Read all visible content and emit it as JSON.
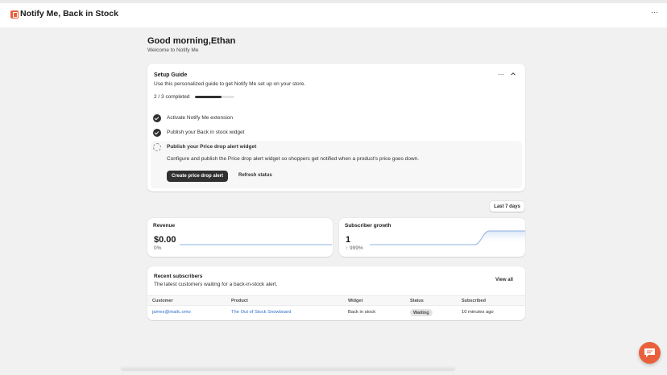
{
  "app": {
    "title": "Notify Me, Back in Stock",
    "more_icon": "dots-horizontal-icon"
  },
  "header": {
    "greeting": "Good morning,Ethan",
    "welcome": "Welcome to Notify Me"
  },
  "setup_guide": {
    "title": "Setup Guide",
    "subtitle": "Use this personalized guide to get Notify Me set up on your store.",
    "progress_text": "2 / 3 completed",
    "progress_fraction": 0.67,
    "tasks": [
      {
        "label": "Activate Notify Me extension",
        "done": true
      },
      {
        "label": "Publish your Back in stock widget",
        "done": true
      },
      {
        "label": "Publish your Price drop alert widget",
        "done": false,
        "description": "Configure and publish the Price drop alert widget so shoppers get notified when a product's price goes down.",
        "primary_action": "Create price drop alert",
        "secondary_action": "Refresh status"
      }
    ]
  },
  "date_range": "Last 7 days",
  "metrics": {
    "revenue": {
      "title": "Revenue",
      "value": "$0.00",
      "delta": "0%"
    },
    "subscriber_growth": {
      "title": "Subscriber growth",
      "value": "1",
      "delta": "↑ 999%"
    }
  },
  "recent_subscribers": {
    "title": "Recent subscribers",
    "subtitle": "The latest customers waiting for a back-in-stock alert.",
    "view_all": "View all",
    "columns": [
      "Customer",
      "Product",
      "Widget",
      "Status",
      "Subscribed"
    ],
    "rows": [
      {
        "customer": "james@mailc.omo",
        "product": "The Out of Stock Snowboard",
        "widget": "Back in stock",
        "status": "Waiting",
        "subscribed": "10 minutes ago"
      }
    ]
  },
  "colors": {
    "brand": "#e8613c",
    "chart_line": "#8fb3e0",
    "link": "#2c6ecb",
    "primary_button": "#303030"
  }
}
